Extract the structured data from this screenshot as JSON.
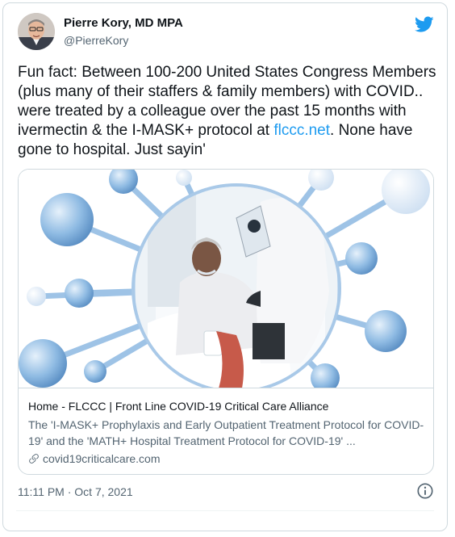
{
  "author": {
    "name": "Pierre Kory, MD MPA",
    "handle": "@PierreKory",
    "avatar_icon": "profile-photo",
    "platform_icon": "twitter-bird-icon"
  },
  "tweet": {
    "text_before_link": "Fun fact: Between 100-200 United States Congress Members (plus many of their staffers & family members) with COVID.. were treated by a colleague over the past 15 months with ivermectin & the I-MASK+ protocol at ",
    "link_text": "flccc.net",
    "text_after_link": ". None have gone to hospital. Just sayin'"
  },
  "card": {
    "title": "Home - FLCCC | Front Line COVID-19 Critical Care Alliance",
    "description": "The 'I-MASK+ Prophylaxis and Early Outpatient Treatment Protocol for COVID-19' and the 'MATH+ Hospital Treatment Protocol for COVID-19' ...",
    "domain": "covid19criticalcare.com",
    "domain_icon": "link-icon"
  },
  "timestamp": "11:11 PM · Oct 7, 2021",
  "info_icon": "info-icon",
  "colors": {
    "link": "#1d9bf0",
    "text": "#0f1419",
    "secondary": "#536471",
    "border": "#cfd9de",
    "virus_blue": "#7fb0dc"
  }
}
